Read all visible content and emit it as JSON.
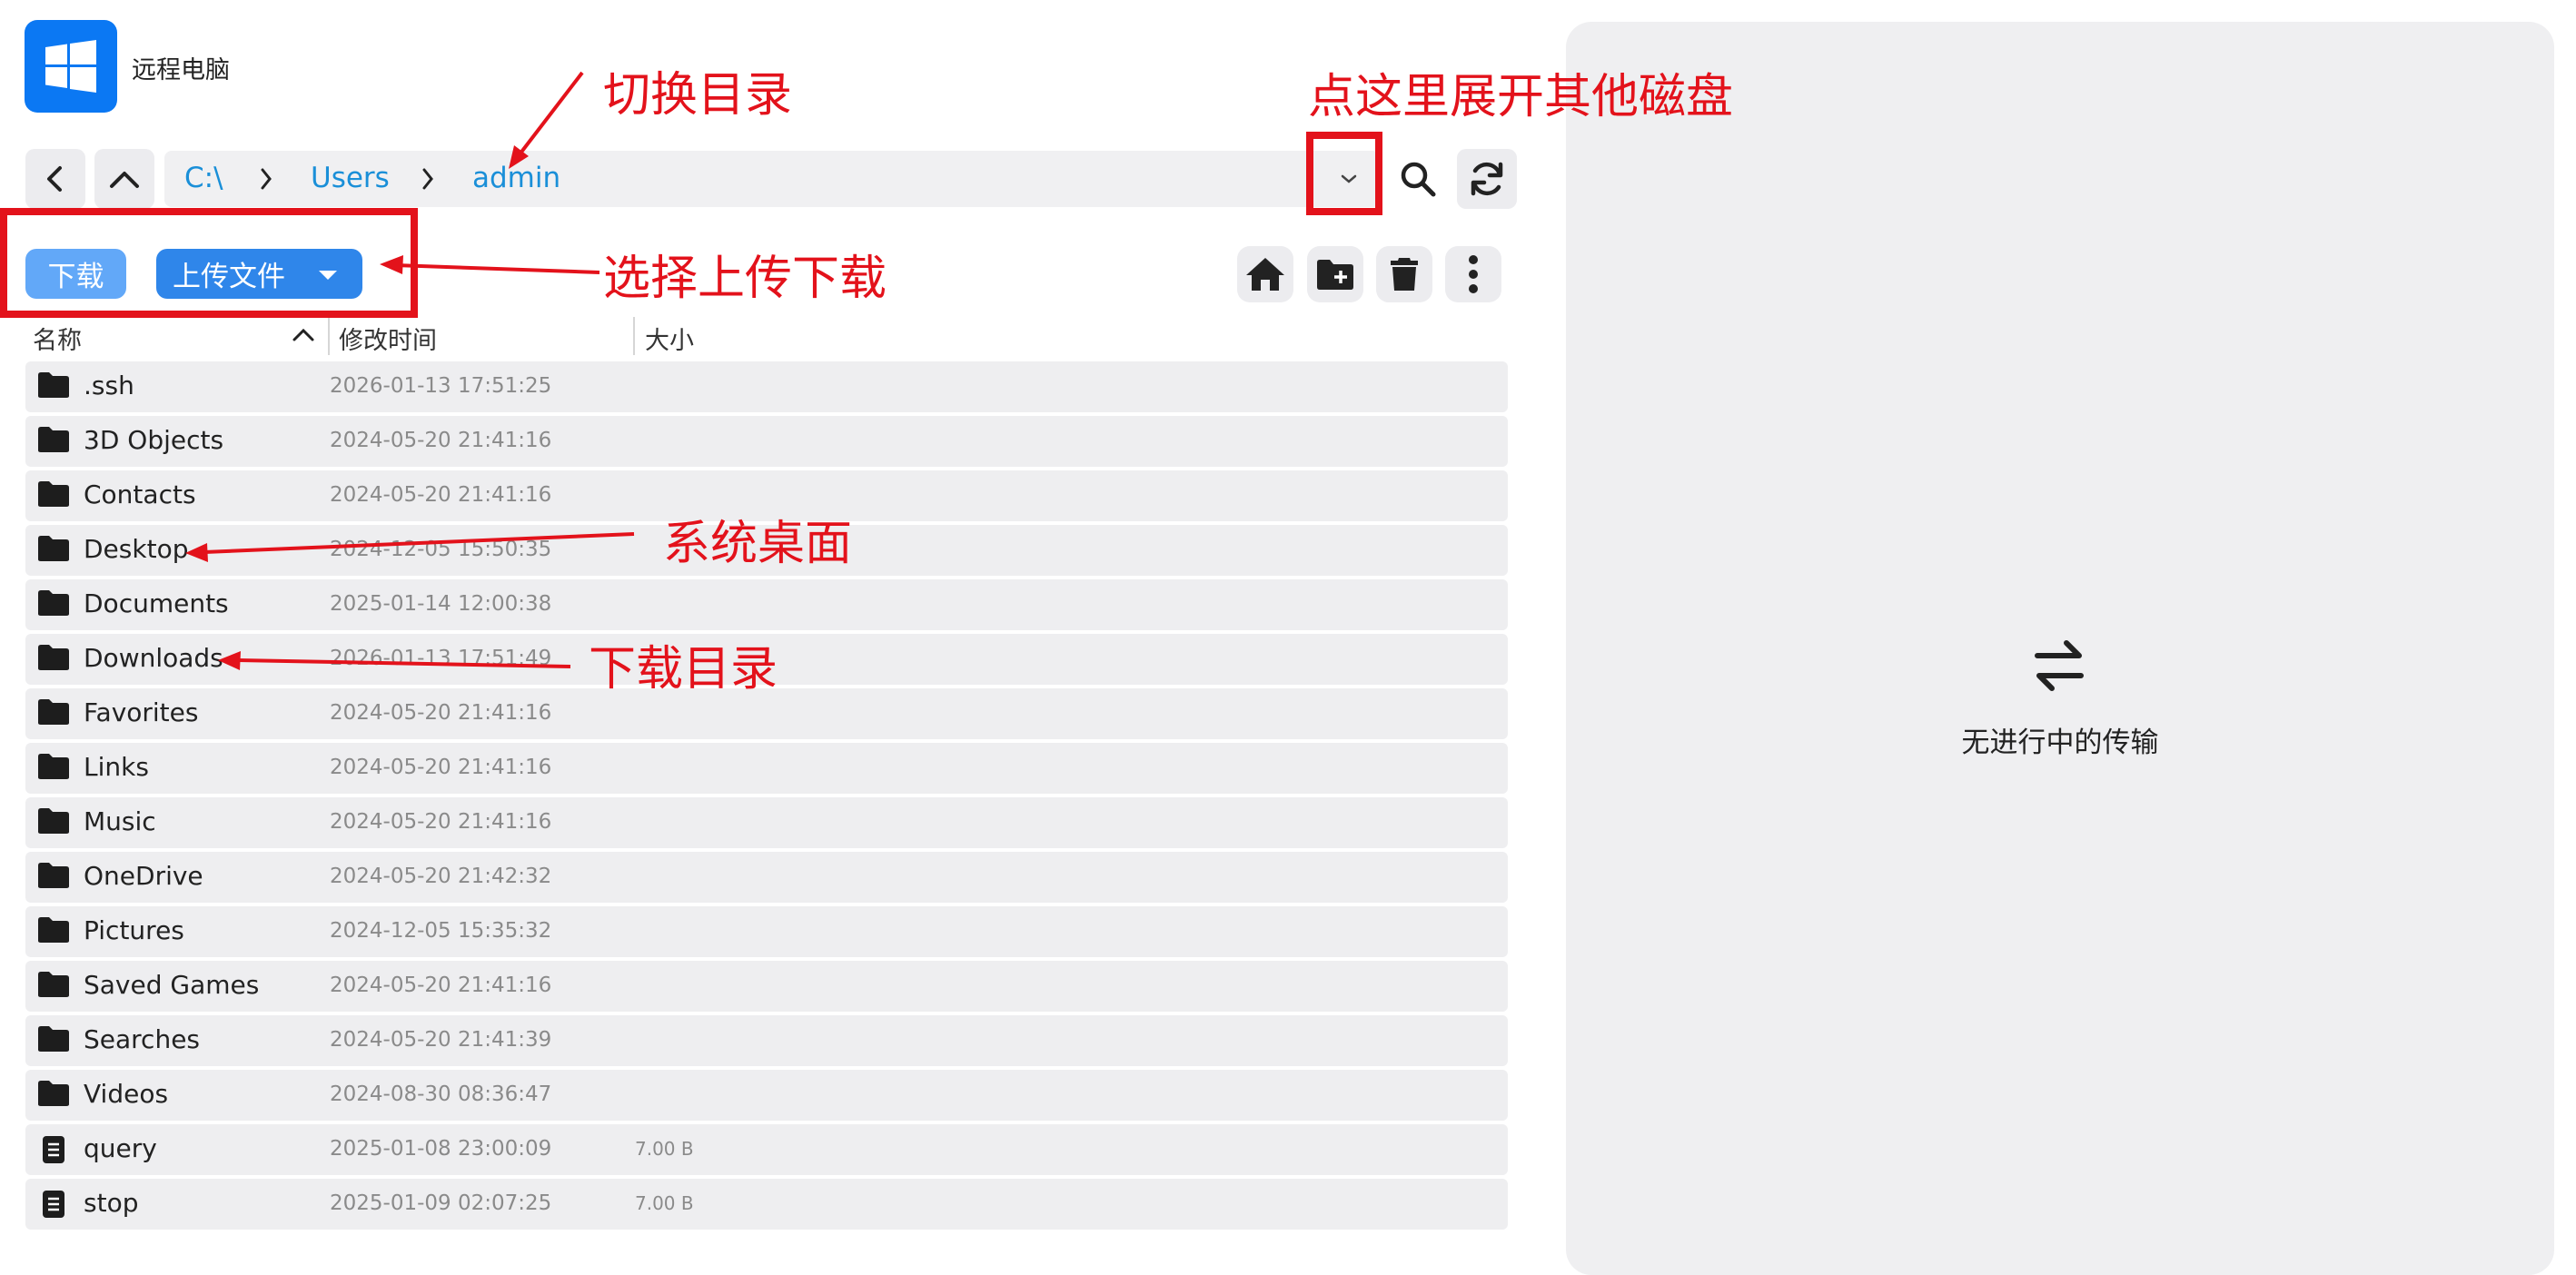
{
  "app": {
    "title": "远程电脑"
  },
  "breadcrumb": {
    "items": [
      "C:\\",
      "Users",
      "admin"
    ]
  },
  "actions": {
    "download_label": "下载",
    "upload_label": "上传文件"
  },
  "table": {
    "headers": {
      "name": "名称",
      "modified": "修改时间",
      "size": "大小"
    },
    "rows": [
      {
        "type": "folder",
        "name": ".ssh",
        "modified": "2026-01-13 17:51:25",
        "size": ""
      },
      {
        "type": "folder",
        "name": "3D Objects",
        "modified": "2024-05-20 21:41:16",
        "size": ""
      },
      {
        "type": "folder",
        "name": "Contacts",
        "modified": "2024-05-20 21:41:16",
        "size": ""
      },
      {
        "type": "folder",
        "name": "Desktop",
        "modified": "2024-12-05 15:50:35",
        "size": ""
      },
      {
        "type": "folder",
        "name": "Documents",
        "modified": "2025-01-14 12:00:38",
        "size": ""
      },
      {
        "type": "folder",
        "name": "Downloads",
        "modified": "2026-01-13 17:51:49",
        "size": ""
      },
      {
        "type": "folder",
        "name": "Favorites",
        "modified": "2024-05-20 21:41:16",
        "size": ""
      },
      {
        "type": "folder",
        "name": "Links",
        "modified": "2024-05-20 21:41:16",
        "size": ""
      },
      {
        "type": "folder",
        "name": "Music",
        "modified": "2024-05-20 21:41:16",
        "size": ""
      },
      {
        "type": "folder",
        "name": "OneDrive",
        "modified": "2024-05-20 21:42:32",
        "size": ""
      },
      {
        "type": "folder",
        "name": "Pictures",
        "modified": "2024-12-05 15:35:32",
        "size": ""
      },
      {
        "type": "folder",
        "name": "Saved Games",
        "modified": "2024-05-20 21:41:16",
        "size": ""
      },
      {
        "type": "folder",
        "name": "Searches",
        "modified": "2024-05-20 21:41:39",
        "size": ""
      },
      {
        "type": "folder",
        "name": "Videos",
        "modified": "2024-08-30 08:36:47",
        "size": ""
      },
      {
        "type": "file",
        "name": "query",
        "modified": "2025-01-08 23:00:09",
        "size": "7.00 B"
      },
      {
        "type": "file",
        "name": "stop",
        "modified": "2025-01-09 02:07:25",
        "size": "7.00 B"
      }
    ]
  },
  "transfer": {
    "empty_text": "无进行中的传输",
    "icon": "transfer-arrows-icon"
  },
  "annotations": {
    "switch_dir": "切换目录",
    "expand_disks": "点这里展开其他磁盘",
    "choose_upload_download": "选择上传下载",
    "desktop": "系统桌面",
    "downloads": "下载目录"
  },
  "colors": {
    "accent": "#2f86ea",
    "link": "#1a8fd8",
    "annotation": "#e3121b",
    "logo": "#0b78f3"
  }
}
